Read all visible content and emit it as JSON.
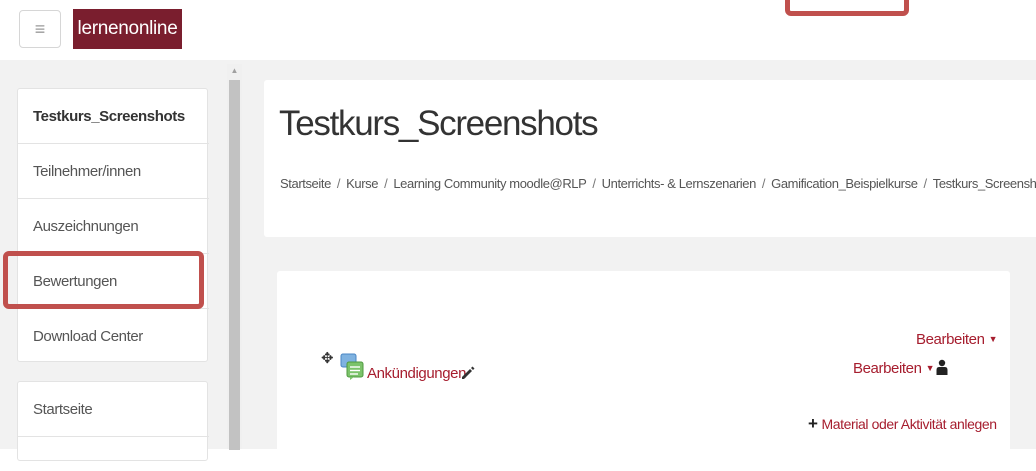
{
  "header": {
    "brand": "lernenonline",
    "menu_icon": "hamburger-icon"
  },
  "sidebar": {
    "items": [
      {
        "label": "Testkurs_Screenshots"
      },
      {
        "label": "Teilnehmer/innen"
      },
      {
        "label": "Auszeichnungen"
      },
      {
        "label": "Bewertungen"
      },
      {
        "label": "Download Center"
      }
    ],
    "items2": [
      {
        "label": "Startseite"
      }
    ]
  },
  "main": {
    "title": "Testkurs_Screenshots",
    "breadcrumb": [
      "Startseite",
      "Kurse",
      "Learning Community moodle@RLP",
      "Unterrichts- & Lernszenarien",
      "Gamification_Beispielkurse",
      "Testkurs_Screenshots"
    ],
    "breadcrumb_sep": "/",
    "section": {
      "edit_section": "Bearbeiten",
      "activity_name": "Ankündigungen",
      "edit_activity": "Bearbeiten",
      "add_activity": "Material oder Aktivität anlegen"
    }
  },
  "colors": {
    "brand": "#7a1e2e",
    "link": "#a61d2e",
    "highlight": "#c0504d"
  }
}
